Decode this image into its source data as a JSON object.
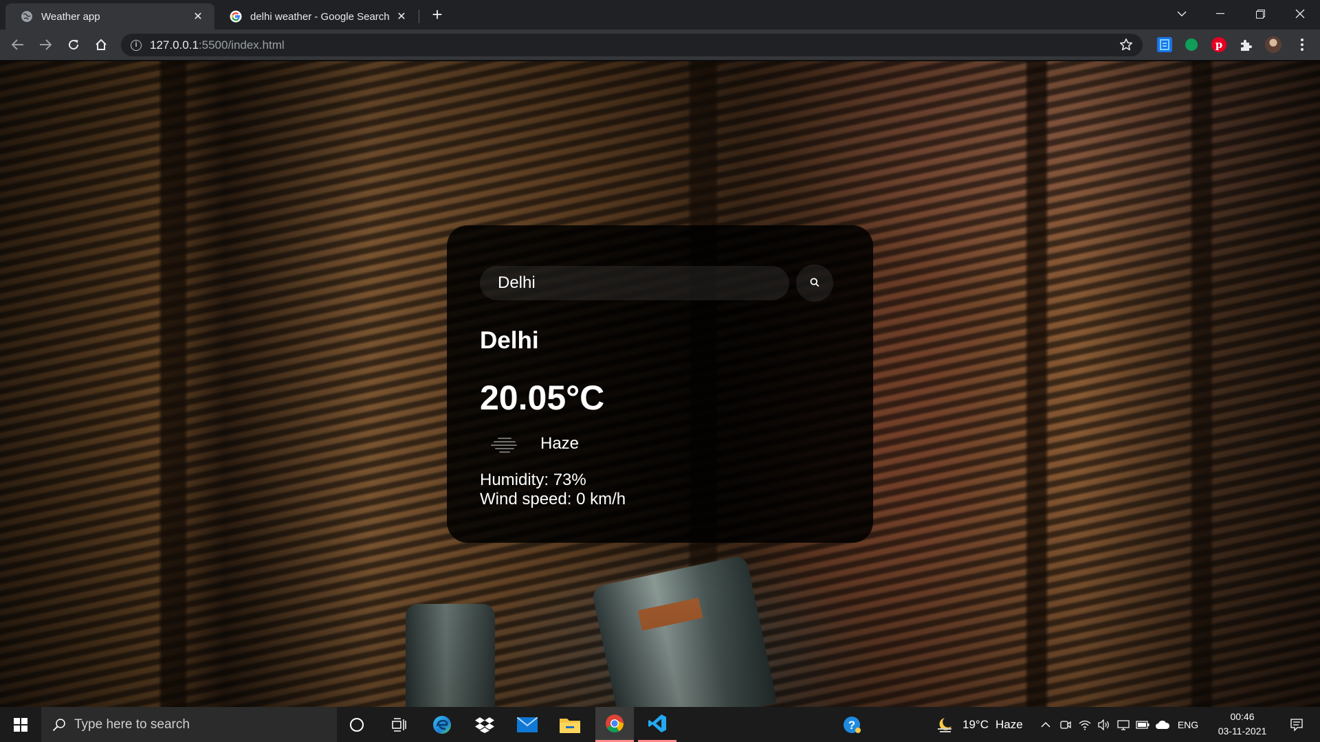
{
  "browser": {
    "tabs": [
      {
        "title": "Weather app",
        "active": true,
        "favicon": "globe-icon"
      },
      {
        "title": "delhi weather - Google Search",
        "active": false,
        "favicon": "google-icon"
      }
    ],
    "address": {
      "host": "127.0.0.1",
      "path": ":5500/index.html"
    },
    "extensions": [
      "document-extension-icon",
      "green-dot-extension-icon",
      "pinterest-icon",
      "puzzle-icon",
      "profile-avatar"
    ]
  },
  "weather": {
    "search_value": "Delhi",
    "city": "Delhi",
    "temperature": "20.05°C",
    "description": "Haze",
    "humidity": "Humidity: 73%",
    "wind": "Wind speed: 0 km/h",
    "description_icon": "haze-icon"
  },
  "taskbar": {
    "search_placeholder": "Type here to search",
    "pinned": [
      "cortana-icon",
      "task-view-icon",
      "edge-icon",
      "dropbox-icon",
      "mail-icon",
      "file-explorer-icon",
      "chrome-icon",
      "vscode-icon"
    ],
    "weather_widget": {
      "temp": "19°C",
      "condition": "Haze"
    },
    "language": "ENG",
    "time": "00:46",
    "date": "03-11-2021"
  },
  "colors": {
    "chrome_dark": "#202124",
    "toolbar": "#35363a",
    "card_bg": "#000000d6",
    "taskbar": "#1b1b1b",
    "running_indicator": "#ff8a8a"
  }
}
